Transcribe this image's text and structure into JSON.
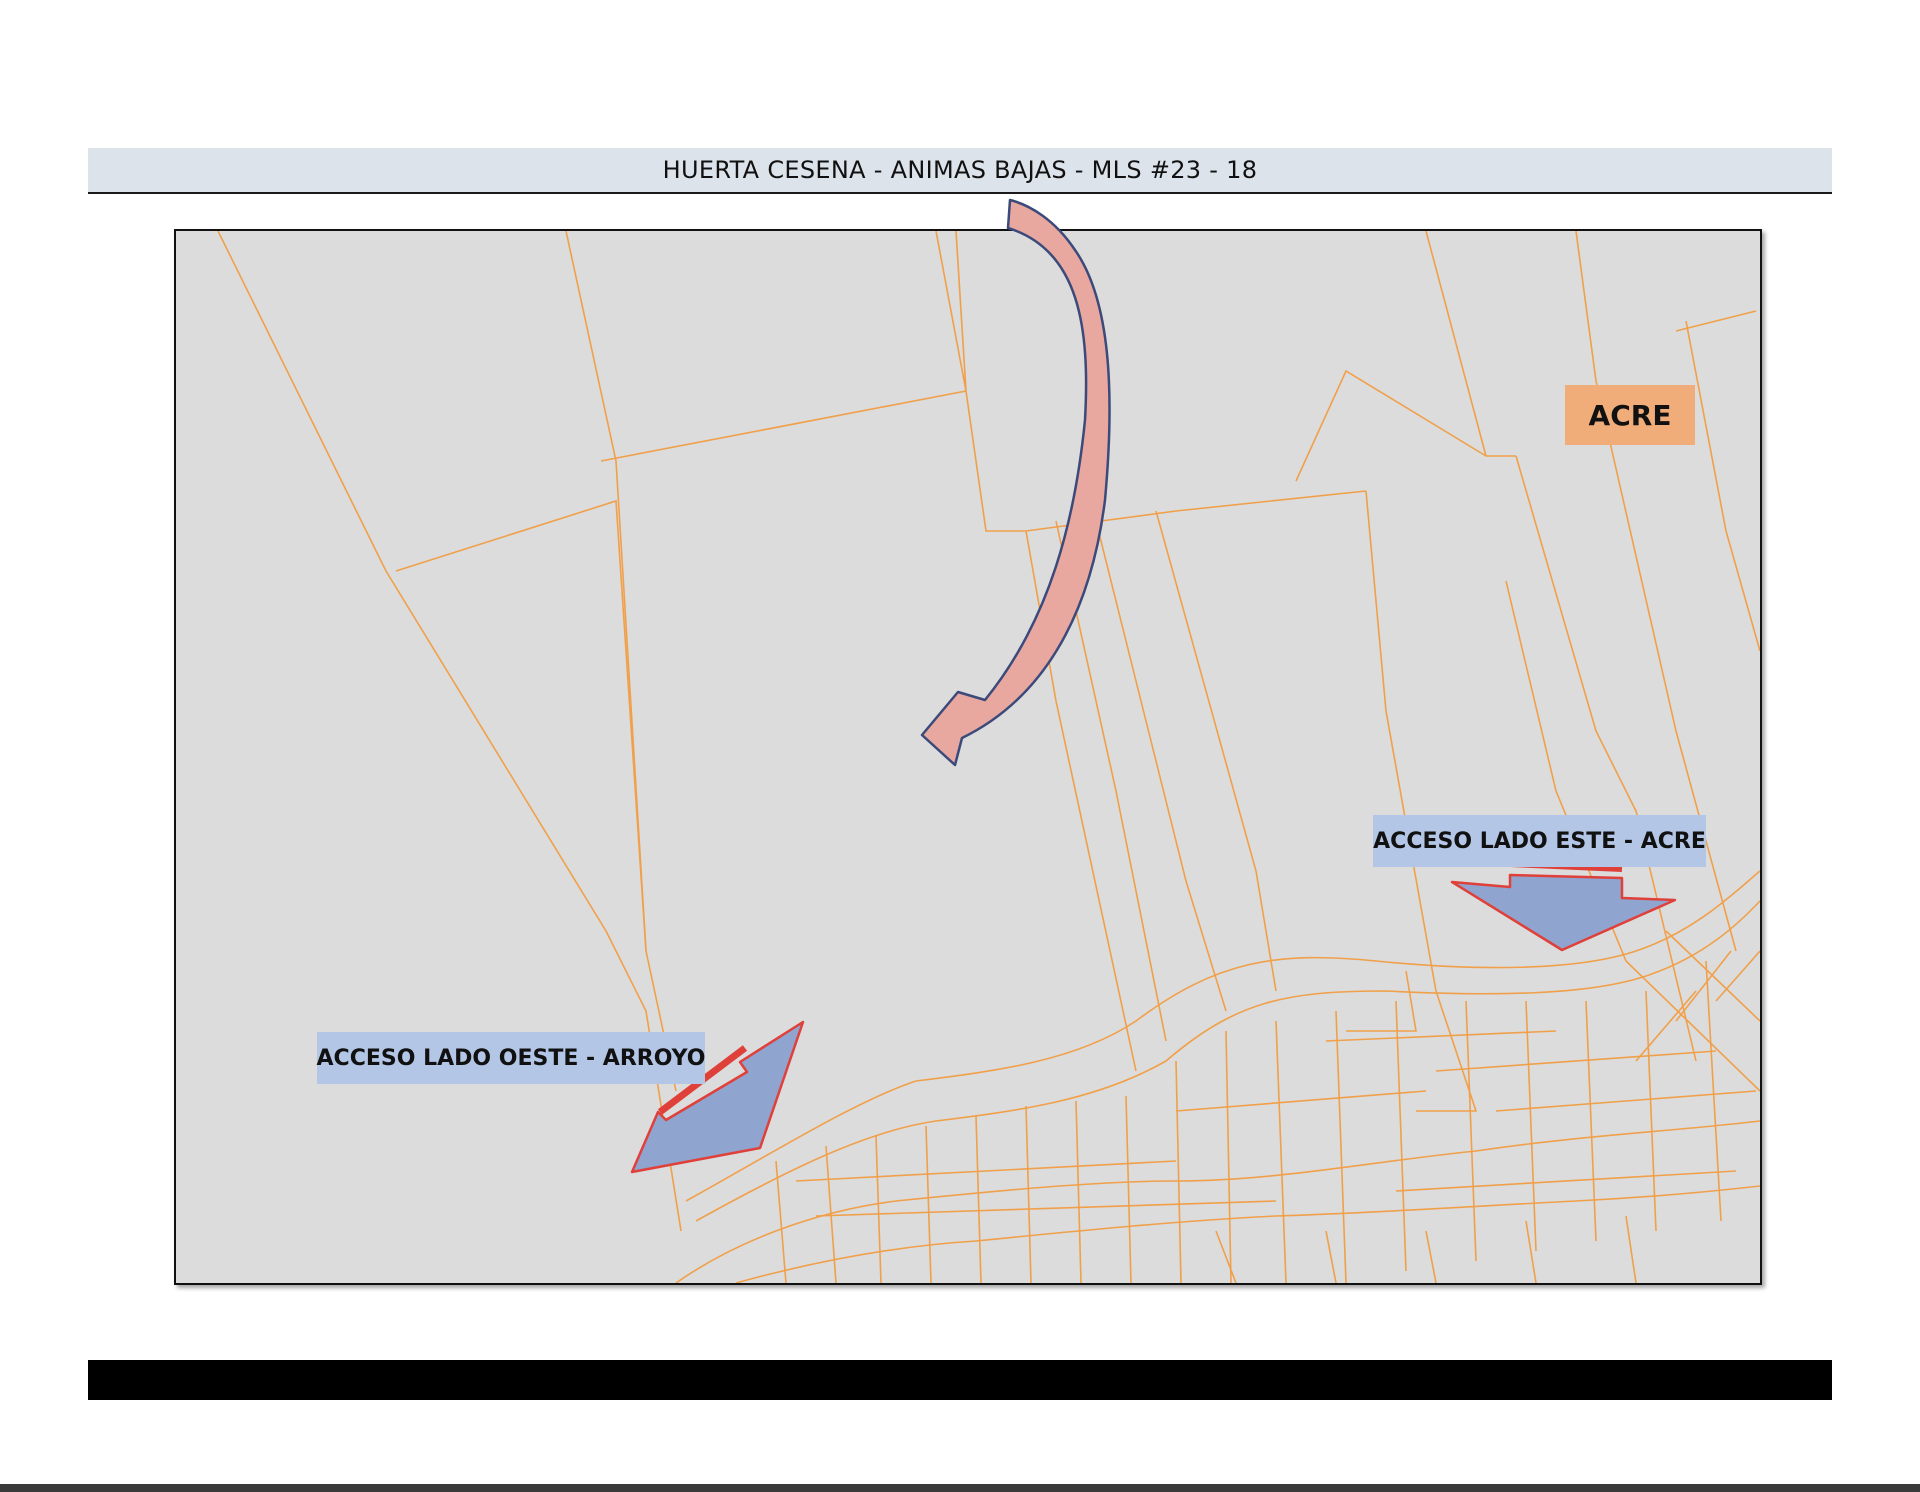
{
  "header": {
    "title": "HUERTA CESENA - ANIMAS BAJAS - MLS #23 - 18"
  },
  "map": {
    "labels": {
      "acre": "ACRE",
      "east_access": "ACCESO LADO ESTE  - ACRE",
      "west_access": "ACCESO LADO OESTE  - ARROYO"
    },
    "colors": {
      "background": "#dcdcdc",
      "parcel_lines": "#f0a04a",
      "acre_label": "#f0ad7a",
      "access_label": "#b3c6e6",
      "access_arrow_fill": "#8fa4cf",
      "access_arrow_outline": "#e0403a",
      "curved_arrow_fill": "#e8a8a0",
      "curved_arrow_outline": "#3b4a7a"
    },
    "icons": [
      "curved-pointer-arrow-icon",
      "east-access-arrow-icon",
      "west-access-arrow-icon"
    ]
  }
}
